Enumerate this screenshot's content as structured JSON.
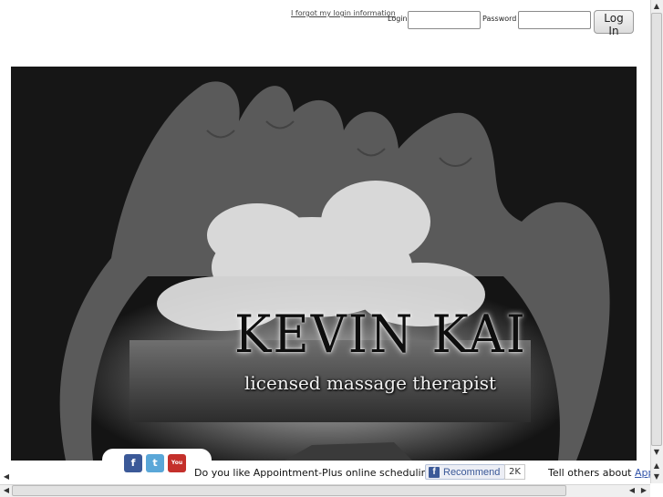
{
  "login_bar": {
    "forgot_link": "I forgot my login information",
    "login_label": "Login",
    "login_value": "",
    "password_label": "Password",
    "password_value": "",
    "submit_label": "Log In"
  },
  "hero": {
    "name": "KEVIN KAI",
    "tagline": "licensed massage therapist"
  },
  "social": {
    "facebook": "f",
    "twitter": "t",
    "youtube": "You Tube"
  },
  "footer": {
    "question": "Do you like Appointment-Plus online scheduling?",
    "recommend_label": "Recommend",
    "recommend_count": "2K",
    "tell_prefix": "Tell others about",
    "tell_link": "App"
  },
  "icons": {
    "facebook": "facebook-icon",
    "twitter": "twitter-icon",
    "youtube": "youtube-icon",
    "scroll_up": "arrow-up-icon",
    "scroll_down": "arrow-down-icon",
    "scroll_left": "arrow-left-icon",
    "scroll_right": "arrow-right-icon"
  },
  "colors": {
    "facebook_blue": "#3b5998",
    "twitter_blue": "#5aa7d8",
    "youtube_red": "#c4302b",
    "hero_bg": "#111111"
  }
}
